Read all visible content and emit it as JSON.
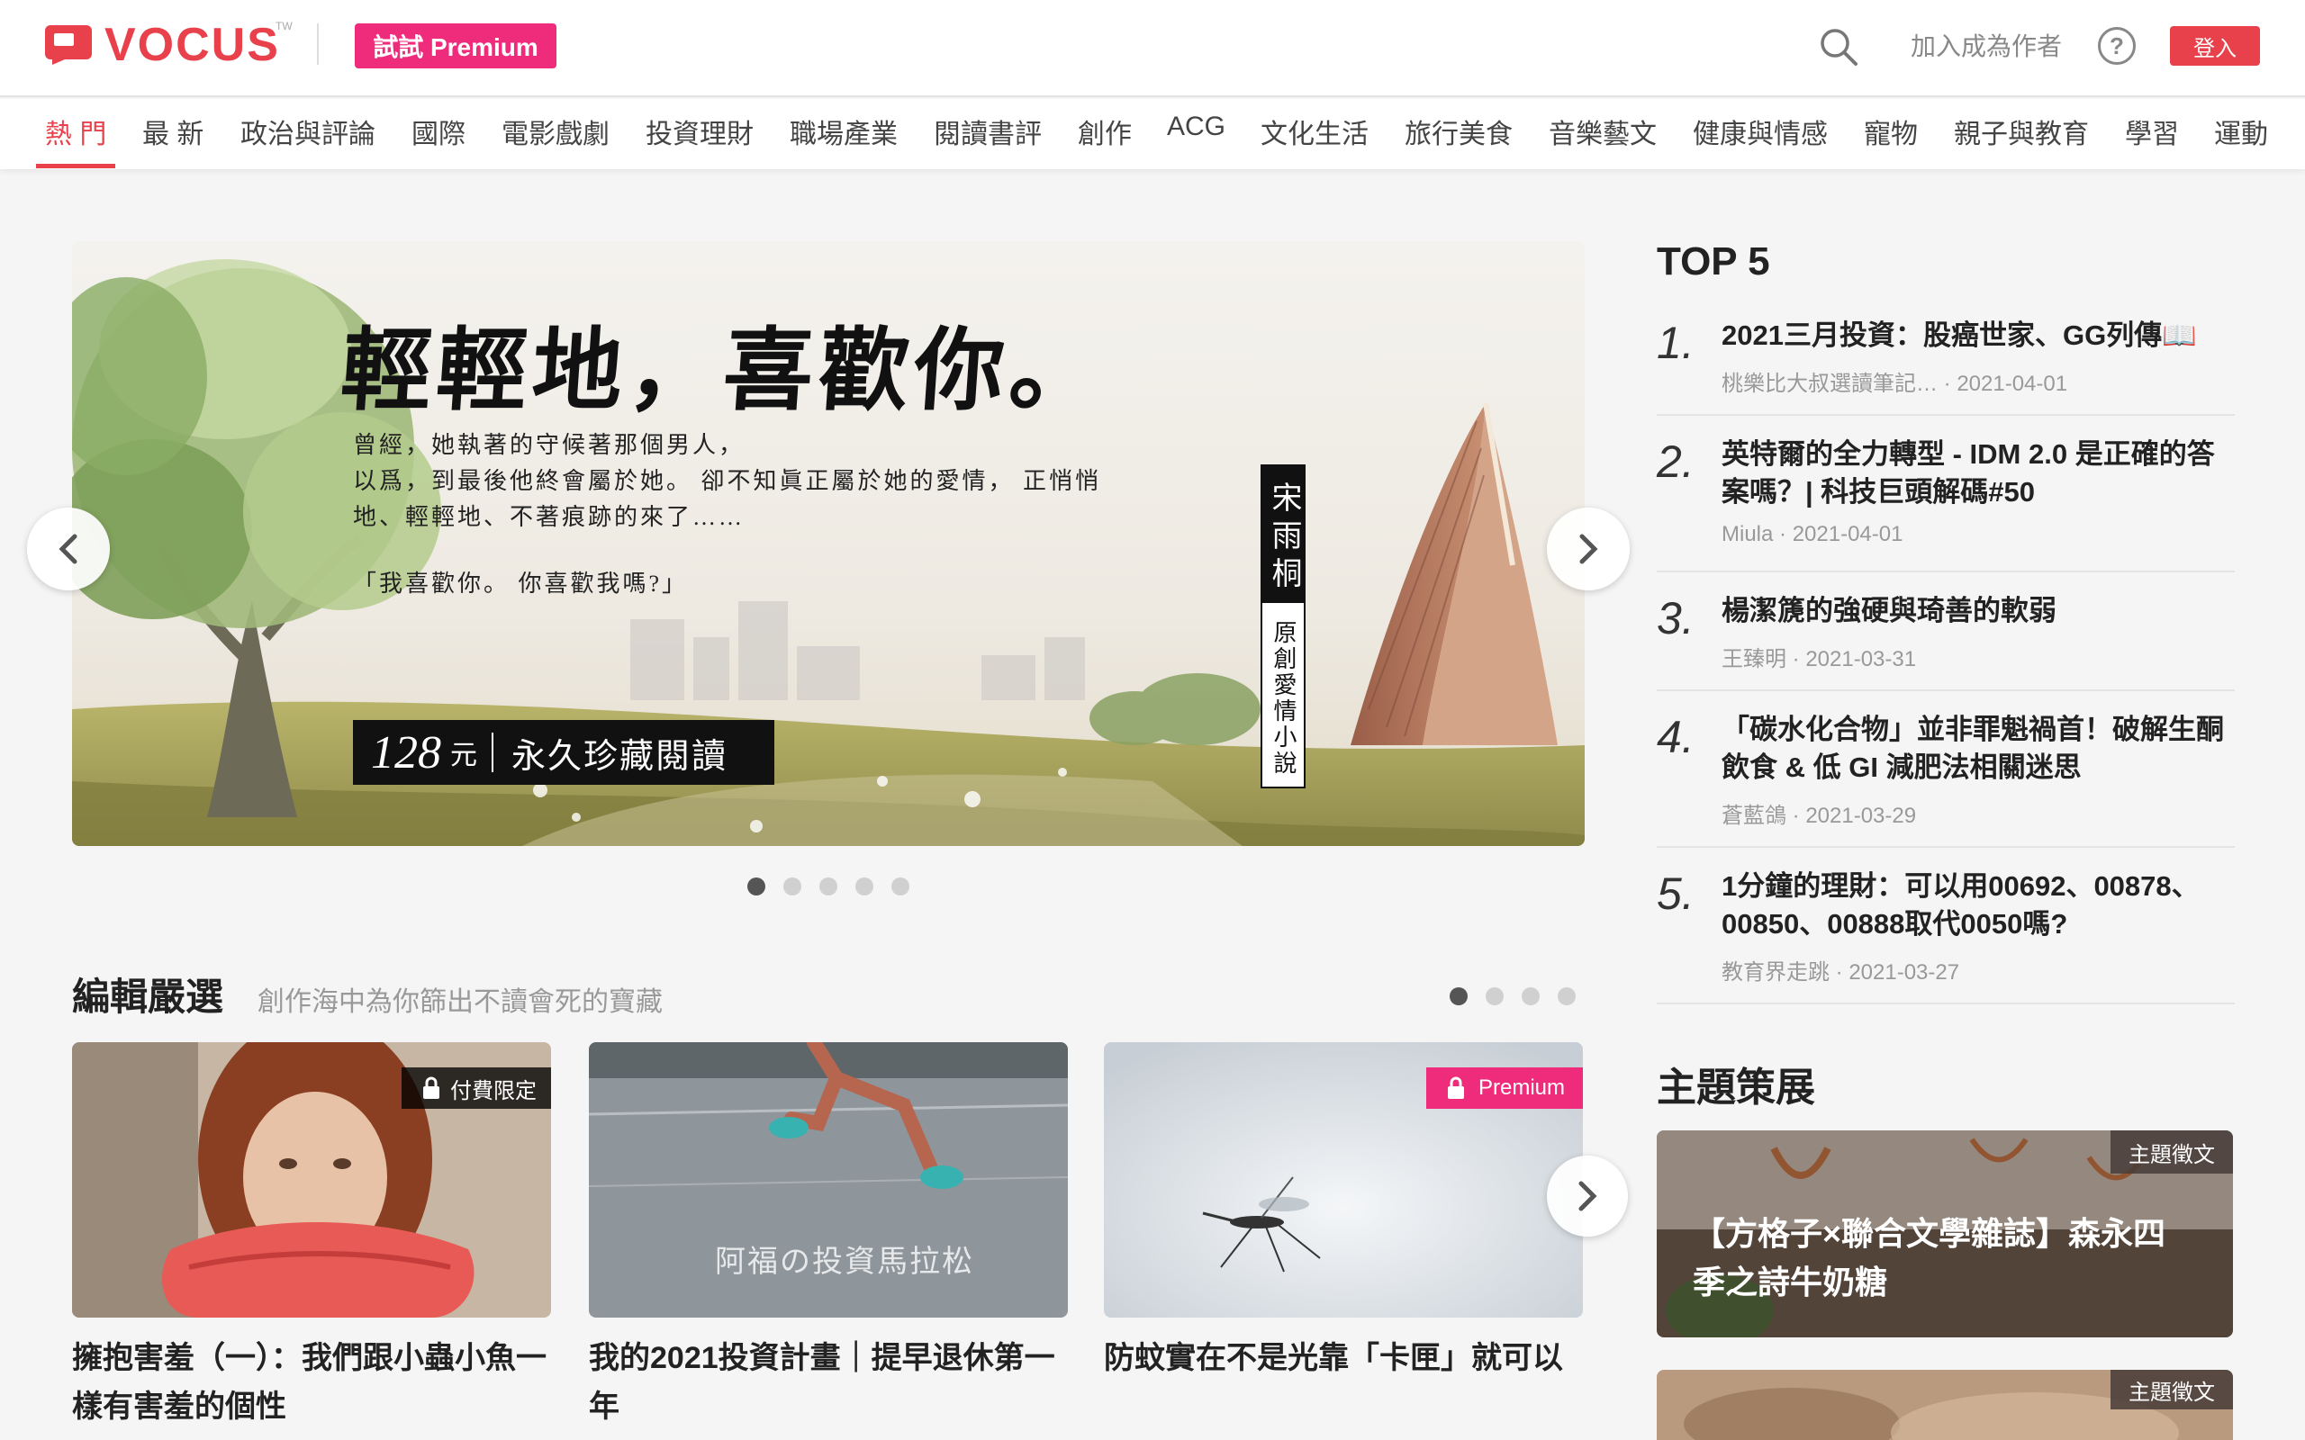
{
  "header": {
    "logo_text": "VOCUS",
    "logo_tm": "TW",
    "premium_label": "試試 Premium",
    "join_label": "加入成為作者",
    "help_label": "?",
    "login_label": "登入",
    "accent_color": "#e8414c",
    "premium_color": "#ef2b7c"
  },
  "nav": {
    "items": [
      "熱 門",
      "最 新",
      "政治與評論",
      "國際",
      "電影戲劇",
      "投資理財",
      "職場產業",
      "閱讀書評",
      "創作",
      "ACG",
      "文化生活",
      "旅行美食",
      "音樂藝文",
      "健康與情感",
      "寵物",
      "親子與教育",
      "學習",
      "運動"
    ],
    "active_index": 0
  },
  "hero": {
    "title": "輕輕地，喜歡你。",
    "lines": [
      "曾經，她執著的守候著那個男人，",
      "以爲，到最後他終會屬於她。 卻不知眞正屬於她的愛情， 正悄悄",
      "地、輕輕地、不著痕跡的來了……",
      "「我喜歡你。 你喜歡我嗎?」"
    ],
    "price_num": "128",
    "price_unit": "元",
    "price_text": "永久珍藏閱讀",
    "author": "宋雨桐",
    "genre": "原創愛情小說",
    "slides": 5,
    "active_slide": 0
  },
  "picks": {
    "title": "編輯嚴選",
    "subtitle": "創作海中為你篩出不讀會死的寶藏",
    "pages": 4,
    "active_page": 0,
    "cards": [
      {
        "title": "擁抱害羞（一）：我們跟小蟲小魚一樣有害羞的個性",
        "badge": "付費限定"
      },
      {
        "title": "我的2021投資計畫｜提早退休第一年",
        "image_text": "阿福の投資馬拉松"
      },
      {
        "title": "防蚊實在不是光靠「卡匣」就可以",
        "badge": "Premium"
      }
    ]
  },
  "top5": {
    "title": "TOP 5",
    "items": [
      {
        "num": "1.",
        "title": "2021三月投資：股癌世家、GG列傳📖",
        "author": "桃樂比大叔選讀筆記…",
        "date": "2021-04-01"
      },
      {
        "num": "2.",
        "title": "英特爾的全力轉型 - IDM 2.0 是正確的答案嗎？| 科技巨頭解碼#50",
        "author": "Miula",
        "date": "2021-04-01"
      },
      {
        "num": "3.",
        "title": "楊潔篪的強硬與琦善的軟弱",
        "author": "王臻明",
        "date": "2021-03-31"
      },
      {
        "num": "4.",
        "title": "「碳水化合物」並非罪魁禍首！破解生酮飲食 & 低 GI 減肥法相關迷思",
        "author": "蒼藍鴿",
        "date": "2021-03-29"
      },
      {
        "num": "5.",
        "title": "1分鐘的理財：可以用00692、00878、00850、00888取代0050嗎?",
        "author": "教育界走跳",
        "date": "2021-03-27"
      }
    ]
  },
  "themes": {
    "title": "主題策展",
    "cards": [
      {
        "badge": "主題徵文",
        "title": "【方格子×聯合文學雜誌】森永四季之詩牛奶糖"
      },
      {
        "badge": "主題徵文",
        "title": ""
      }
    ]
  }
}
